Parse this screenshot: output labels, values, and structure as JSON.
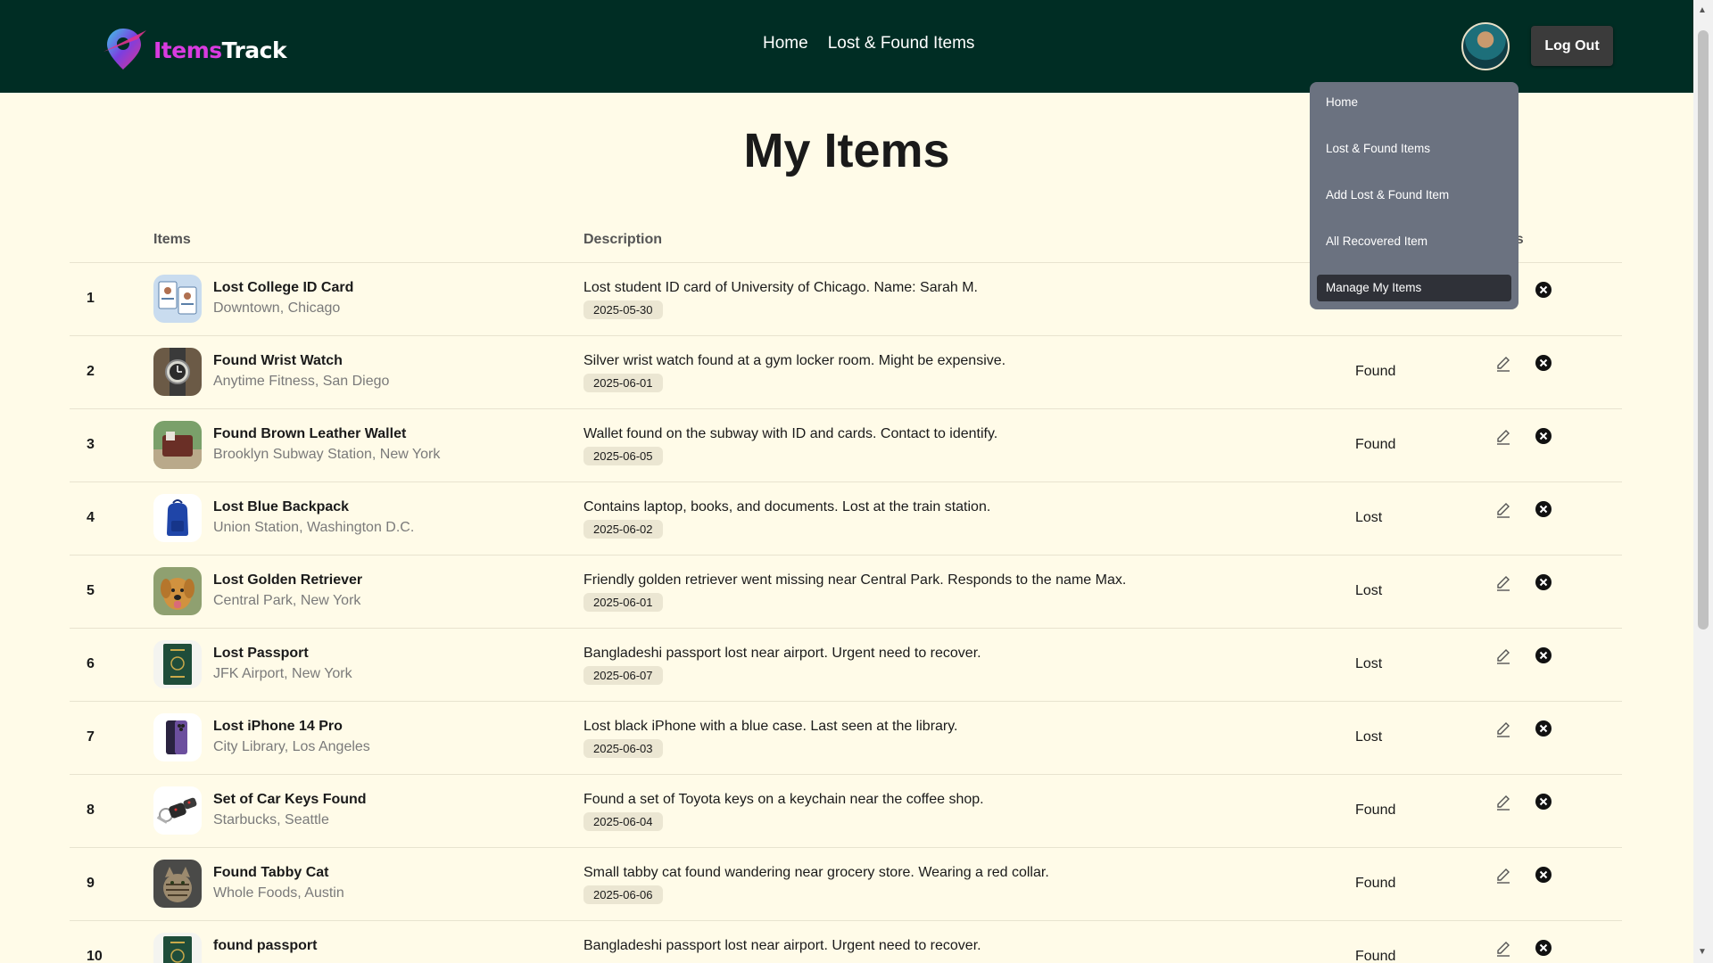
{
  "brand": {
    "name_part1": "Items",
    "name_part2": "Track",
    "accent": "#d93be0",
    "nav_bg": "#002d24",
    "page_bg": "#fffbe8"
  },
  "nav": {
    "links": [
      "Home",
      "Lost & Found Items"
    ],
    "logout_label": "Log Out"
  },
  "dropdown": {
    "items": [
      "Home",
      "Lost & Found Items",
      "Add Lost & Found Item",
      "All Recovered Item",
      "Manage My Items"
    ],
    "active": "Manage My Items"
  },
  "page": {
    "title": "My Items"
  },
  "table": {
    "headers": {
      "items": "Items",
      "description": "Description",
      "actions_partial": "ns"
    },
    "rows": [
      {
        "num": "1",
        "name": "Lost College ID Card",
        "location": "Downtown, Chicago",
        "description": "Lost student ID card of University of Chicago. Name: Sarah M.",
        "date": "2025-05-30",
        "status": "",
        "thumb": "id-card"
      },
      {
        "num": "2",
        "name": "Found Wrist Watch",
        "location": "Anytime Fitness, San Diego",
        "description": "Silver wrist watch found at a gym locker room. Might be expensive.",
        "date": "2025-06-01",
        "status": "Found",
        "thumb": "watch"
      },
      {
        "num": "3",
        "name": "Found Brown Leather Wallet",
        "location": "Brooklyn Subway Station, New York",
        "description": "Wallet found on the subway with ID and cards. Contact to identify.",
        "date": "2025-06-05",
        "status": "Found",
        "thumb": "wallet"
      },
      {
        "num": "4",
        "name": "Lost Blue Backpack",
        "location": "Union Station, Washington D.C.",
        "description": "Contains laptop, books, and documents. Lost at the train station.",
        "date": "2025-06-02",
        "status": "Lost",
        "thumb": "backpack"
      },
      {
        "num": "5",
        "name": "Lost Golden Retriever",
        "location": "Central Park, New York",
        "description": "Friendly golden retriever went missing near Central Park. Responds to the name Max.",
        "date": "2025-06-01",
        "status": "Lost",
        "thumb": "dog"
      },
      {
        "num": "6",
        "name": "Lost Passport",
        "location": "JFK Airport, New York",
        "description": "Bangladeshi passport lost near airport. Urgent need to recover.",
        "date": "2025-06-07",
        "status": "Lost",
        "thumb": "passport"
      },
      {
        "num": "7",
        "name": "Lost iPhone 14 Pro",
        "location": "City Library, Los Angeles",
        "description": "Lost black iPhone with a blue case. Last seen at the library.",
        "date": "2025-06-03",
        "status": "Lost",
        "thumb": "phone"
      },
      {
        "num": "8",
        "name": "Set of Car Keys Found",
        "location": "Starbucks, Seattle",
        "description": "Found a set of Toyota keys on a keychain near the coffee shop.",
        "date": "2025-06-04",
        "status": "Found",
        "thumb": "keys"
      },
      {
        "num": "9",
        "name": "Found Tabby Cat",
        "location": "Whole Foods, Austin",
        "description": "Small tabby cat found wandering near grocery store. Wearing a red collar.",
        "date": "2025-06-06",
        "status": "Found",
        "thumb": "cat"
      },
      {
        "num": "10",
        "name": "found passport",
        "location": "",
        "description": "Bangladeshi passport lost near airport. Urgent need to recover.",
        "date": "",
        "status": "Found",
        "thumb": "passport"
      }
    ]
  }
}
